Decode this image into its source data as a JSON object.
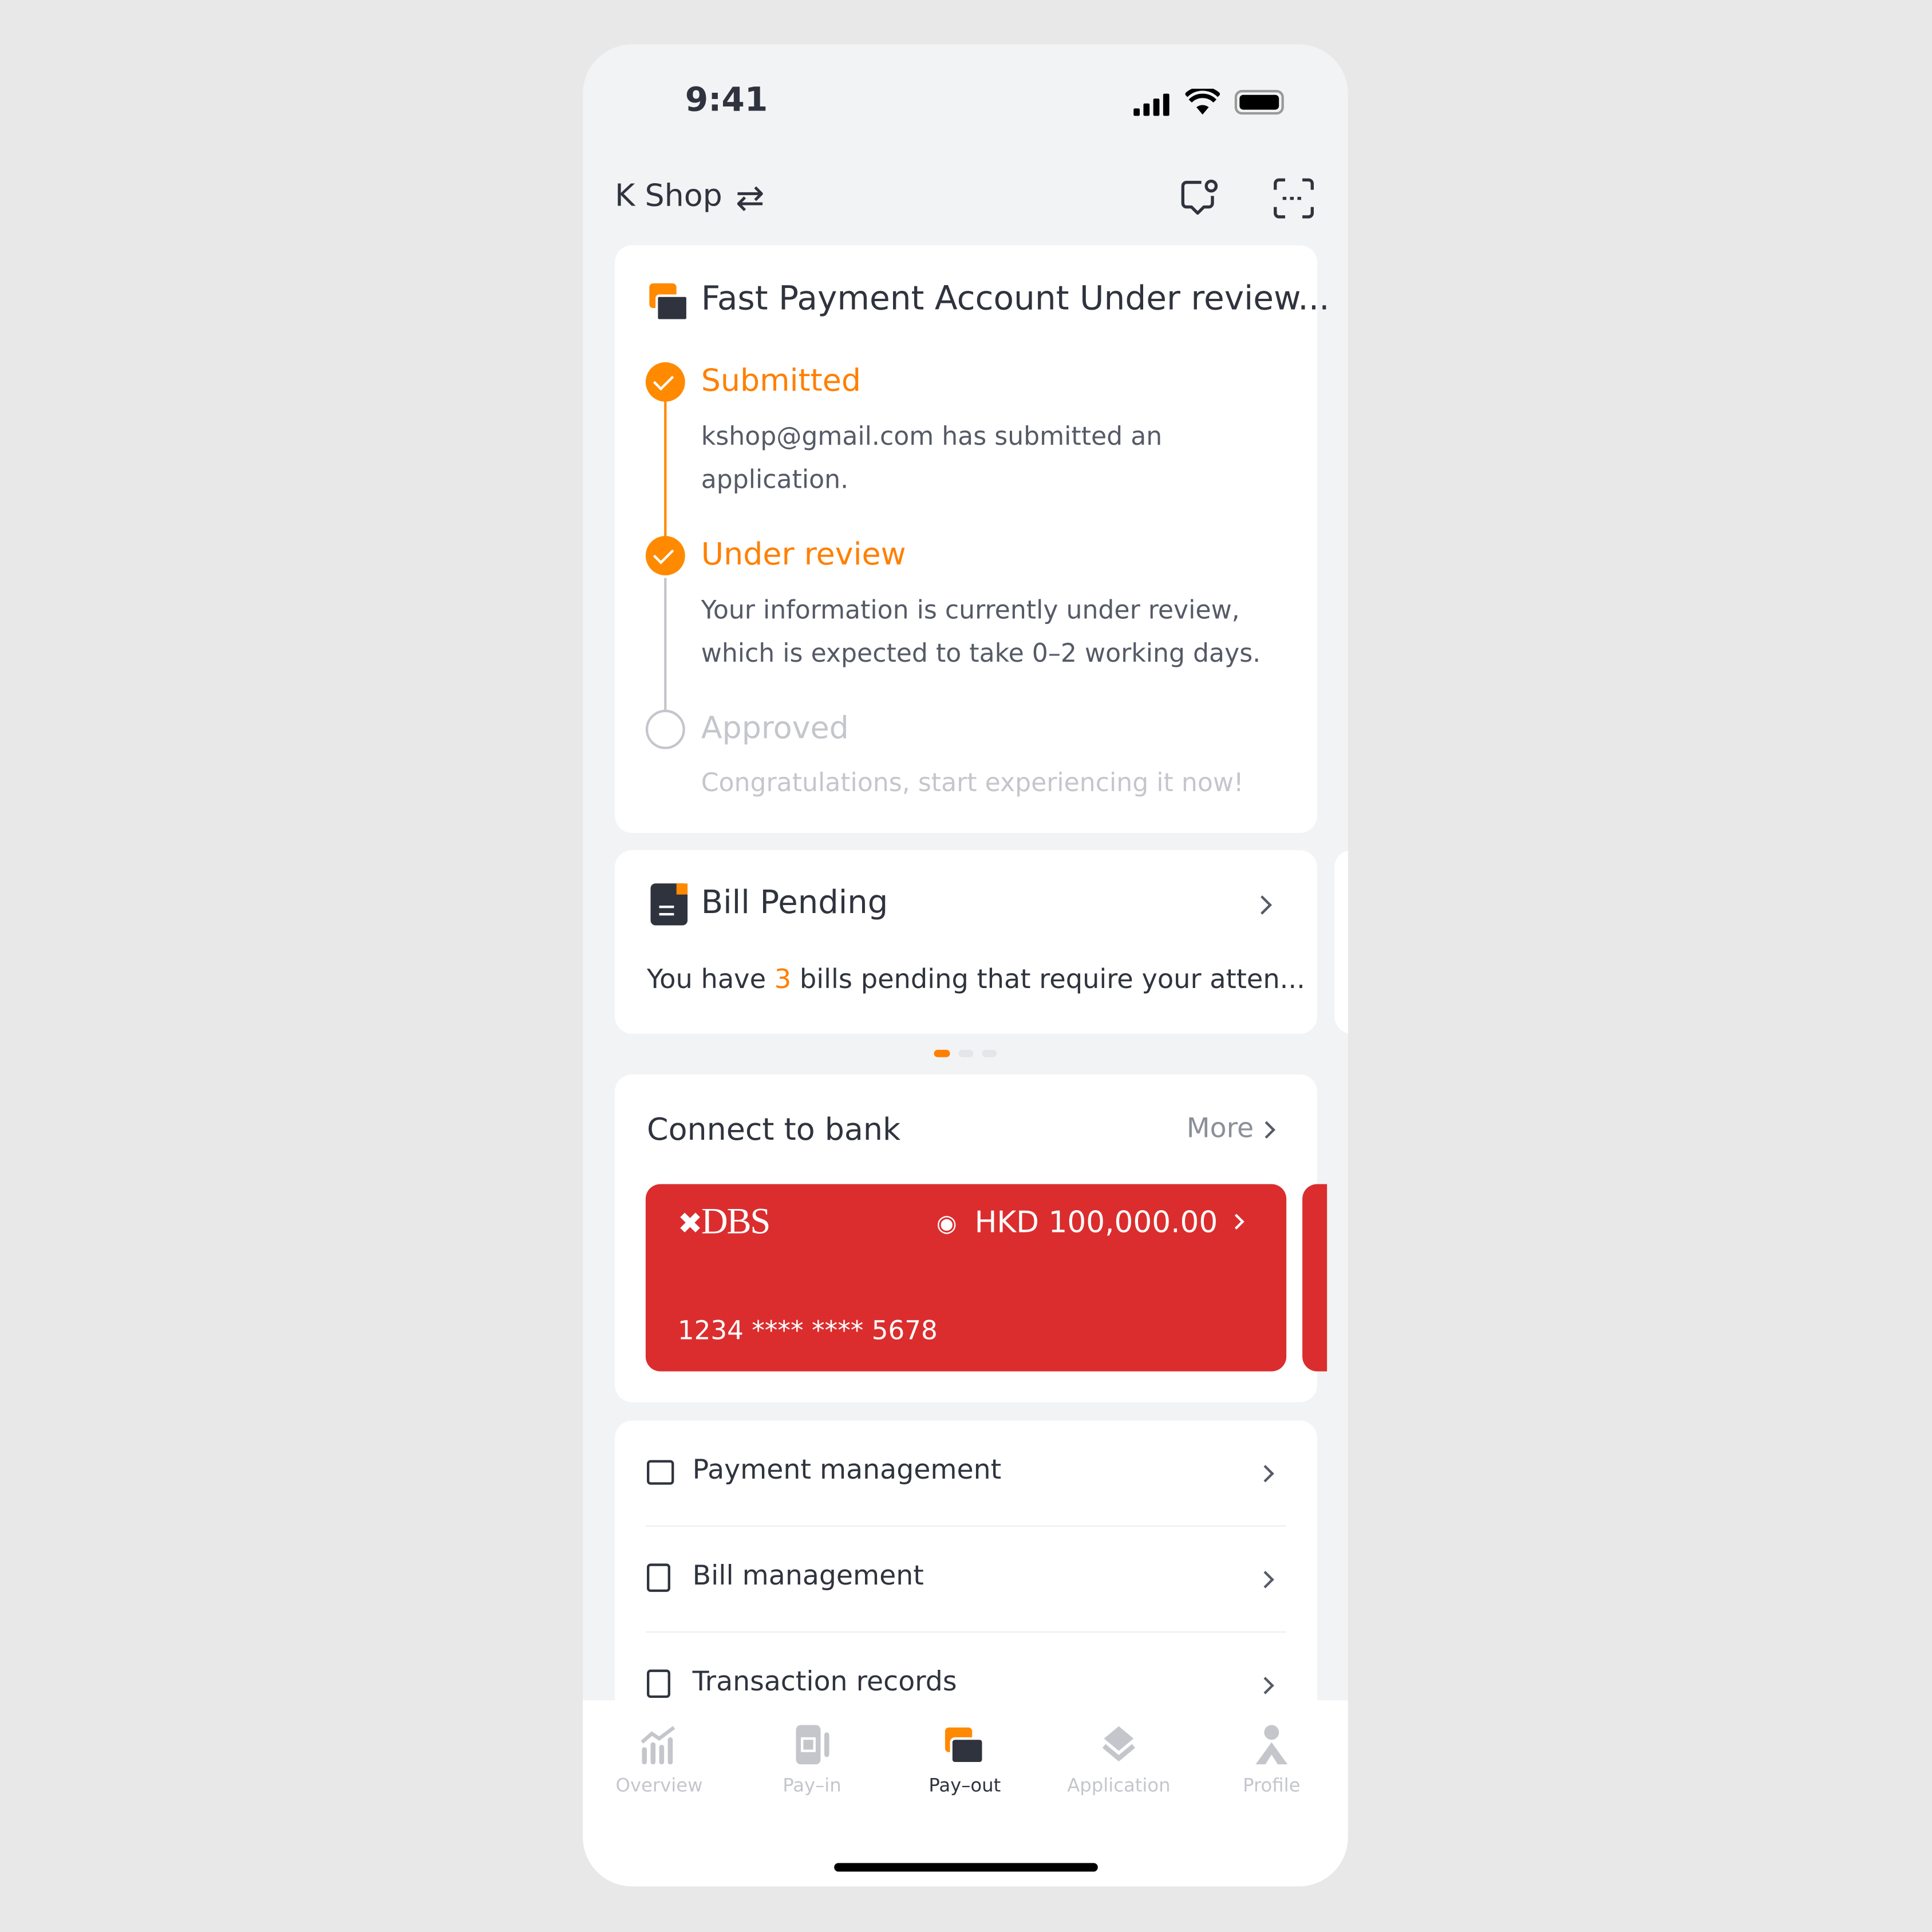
{
  "status_bar": {
    "time": "9:41"
  },
  "header": {
    "shop_name": "K Shop",
    "switch_icon": "swap-arrows-icon",
    "icons": [
      "chat-bubble-icon",
      "scan-icon"
    ]
  },
  "fast_payment": {
    "title": "Fast Payment Account Under review...",
    "steps": [
      {
        "title": "Submitted",
        "desc": "kshop@gmail.com has submitted an application.",
        "status": "done"
      },
      {
        "title": "Under review",
        "desc": "Your information is currently under review, which is expected to take 0–2 working days.",
        "status": "done"
      },
      {
        "title": "Approved",
        "desc": "Congratulations, start experiencing it now!",
        "status": "pending"
      }
    ]
  },
  "bill_pending": {
    "title": "Bill Pending",
    "desc_prefix": "You have ",
    "count": "3",
    "desc_suffix": " bills pending that require your atten...",
    "carousel_pages": 3,
    "carousel_active": 1
  },
  "bank": {
    "title": "Connect to bank",
    "more_label": "More",
    "card": {
      "bank": "DBS",
      "balance": "HKD 100,000.00",
      "number": "1234 **** **** 5678",
      "color": "#db2d2e"
    }
  },
  "menu": [
    {
      "label": "Payment management",
      "icon": "card-icon"
    },
    {
      "label": "Bill management",
      "icon": "document-icon"
    },
    {
      "label": "Transaction records",
      "icon": "receipt-search-icon"
    }
  ],
  "tabs": [
    {
      "label": "Overview",
      "active": false
    },
    {
      "label": "Pay–in",
      "active": false
    },
    {
      "label": "Pay–out",
      "active": true
    },
    {
      "label": "Application",
      "active": false
    },
    {
      "label": "Profile",
      "active": false
    }
  ],
  "colors": {
    "accent": "#ff8000",
    "text": "#2f333d",
    "muted": "#c4c6cc"
  }
}
